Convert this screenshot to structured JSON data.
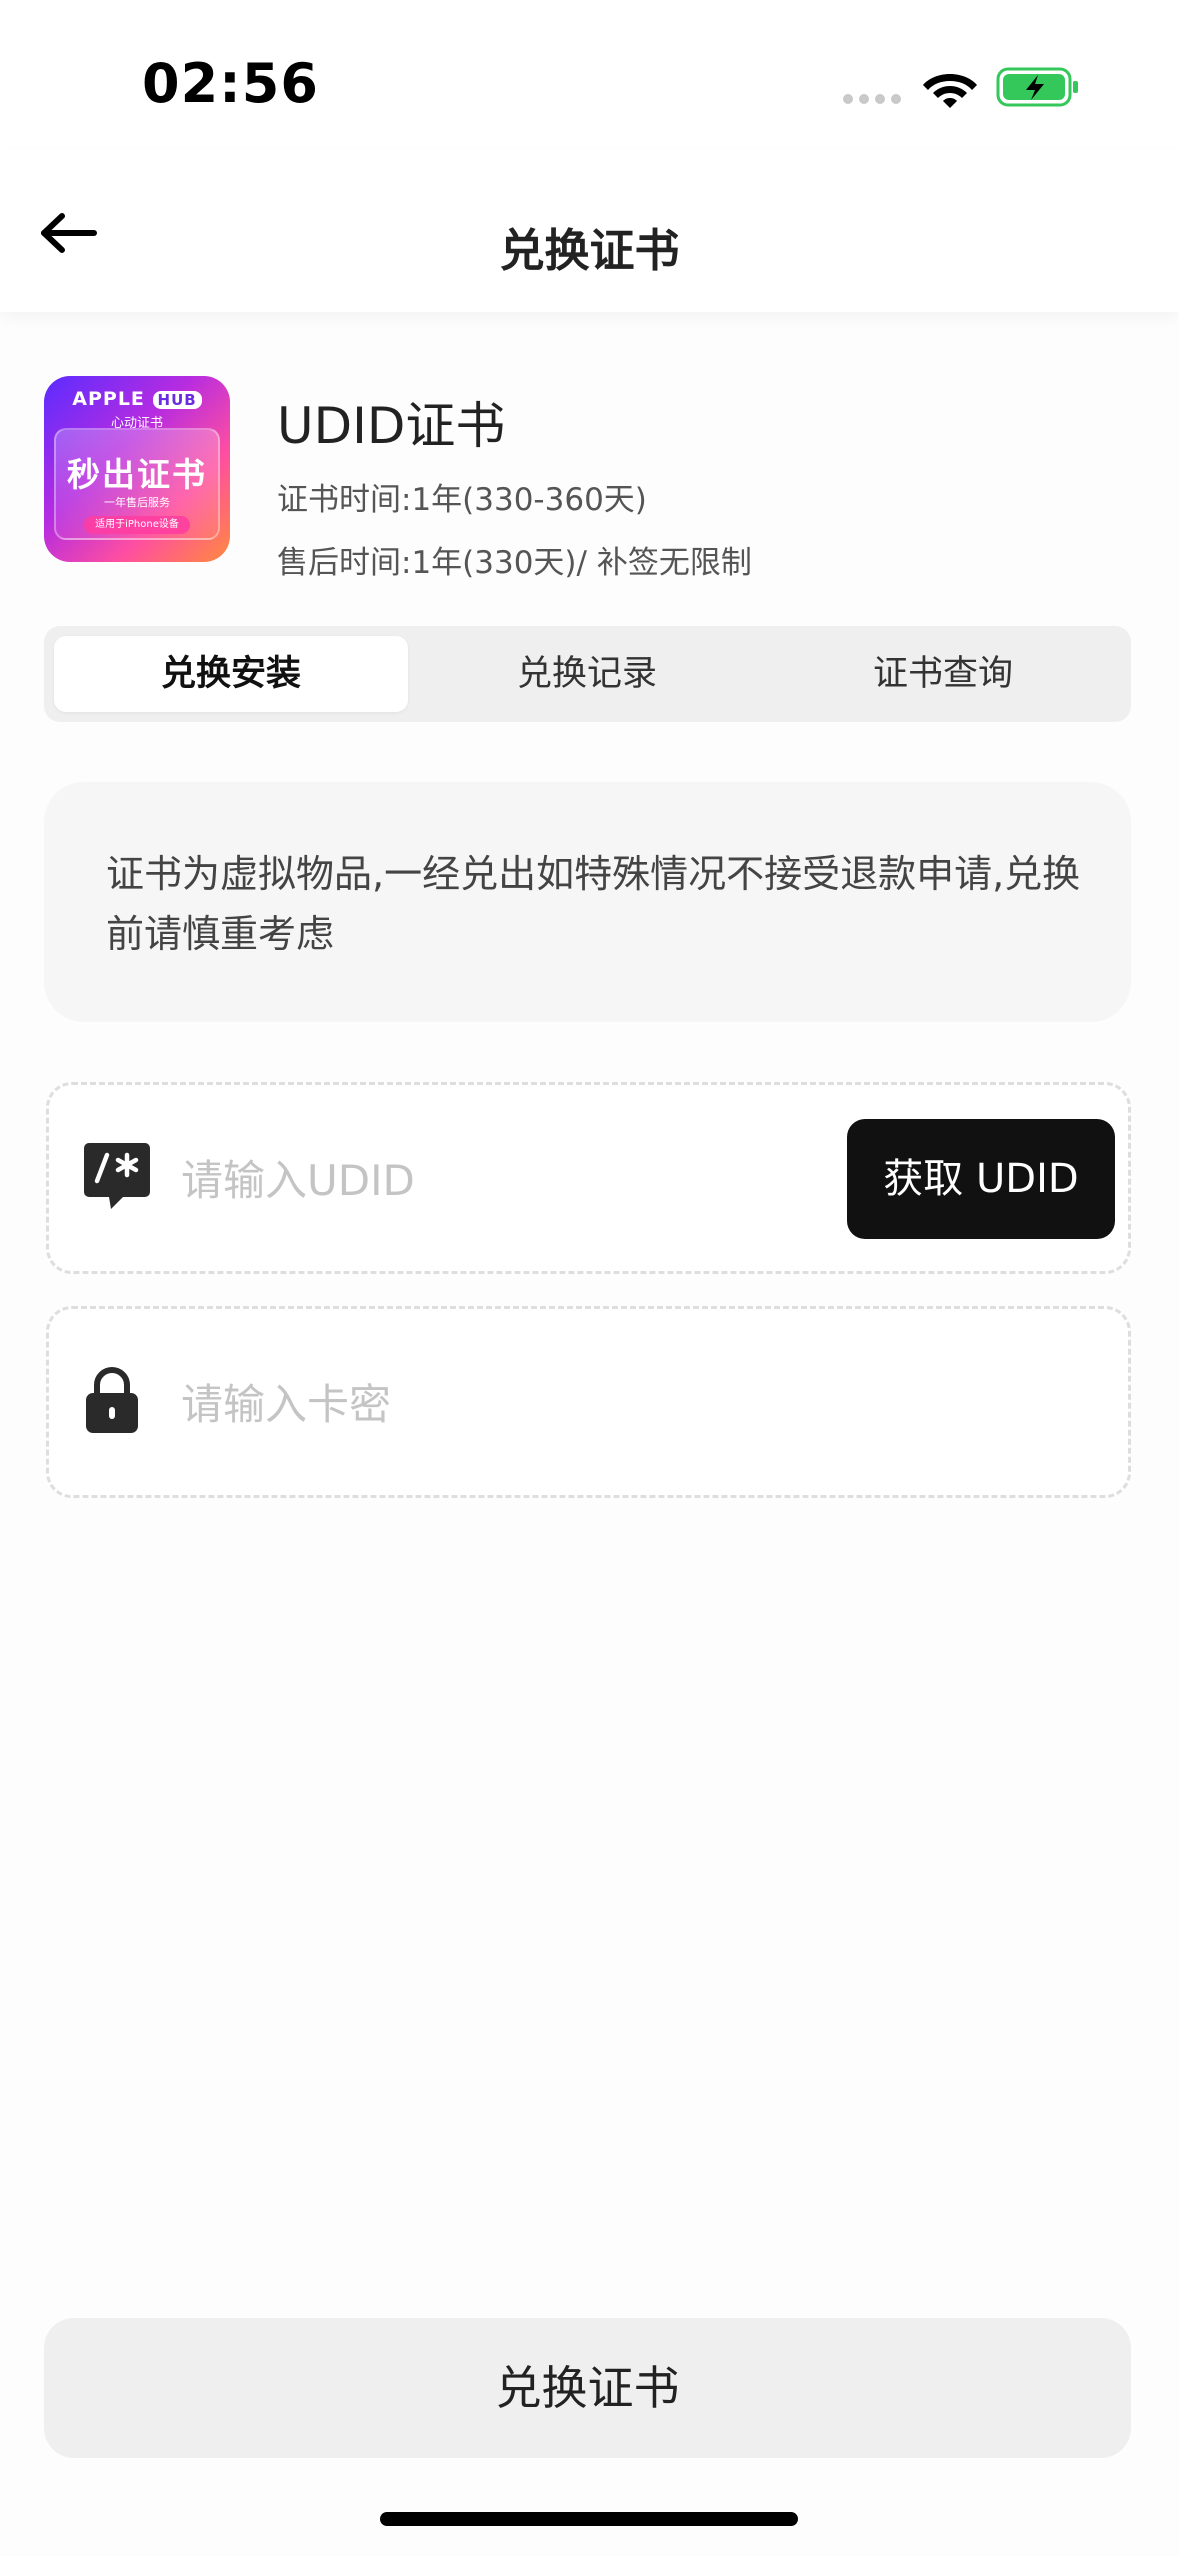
{
  "status_bar": {
    "time": "02:56"
  },
  "nav": {
    "title": "兑换证书",
    "back_icon": "arrow-left-icon"
  },
  "product": {
    "name": "UDID证书",
    "cert_time": "证书时间:1年(330-360天)",
    "after_sales": "售后时间:1年(330天)/ 补签无限制",
    "thumbnail": {
      "brand": "APPLE",
      "brand_badge": "HUB",
      "subtitle": "心动证书",
      "main_text": "秒出证书",
      "line": "一年售后服务",
      "pill": "适用于iPhone设备"
    }
  },
  "tabs": [
    {
      "label": "兑换安装",
      "active": true
    },
    {
      "label": "兑换记录",
      "active": false
    },
    {
      "label": "证书查询",
      "active": false
    }
  ],
  "notice": {
    "text": "证书为虚拟物品,一经兑出如特殊情况不接受退款申请,兑换前请慎重考虑"
  },
  "form": {
    "udid": {
      "placeholder": "请输入UDID",
      "value": "",
      "icon": "code-comment-icon",
      "button_label": "获取 UDID"
    },
    "card_key": {
      "placeholder": "请输入卡密",
      "value": "",
      "icon": "lock-icon"
    }
  },
  "submit": {
    "label": "兑换证书"
  },
  "colors": {
    "primary_dark": "#111111",
    "notice_bg": "#f6f6f6",
    "tab_bg": "#efefef",
    "battery_green": "#34c759"
  }
}
